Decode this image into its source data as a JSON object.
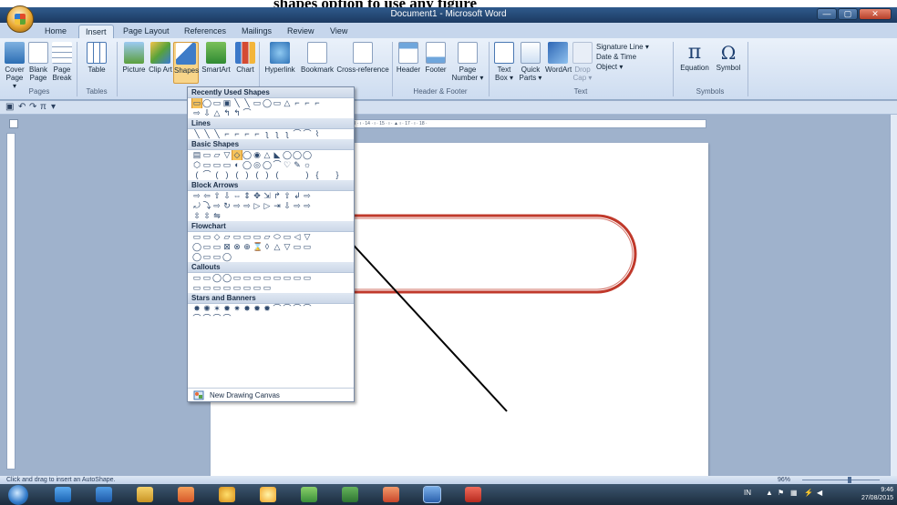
{
  "heading": "shapes option to use any figure",
  "window": {
    "title": "Document1 - Microsoft Word",
    "buttons": [
      "—",
      "▢",
      "✕"
    ]
  },
  "tabs": [
    "Home",
    "Insert",
    "Page Layout",
    "References",
    "Mailings",
    "Review",
    "View"
  ],
  "active_tab": "Insert",
  "ribbon": {
    "pages": {
      "buttons": [
        "Cover Page ▾",
        "Blank Page",
        "Page Break"
      ],
      "label": "Pages"
    },
    "tables": {
      "buttons": [
        "Table"
      ],
      "label": "Tables"
    },
    "illustrations": {
      "buttons": [
        "Picture",
        "Clip Art",
        "Shapes",
        "SmartArt",
        "Chart"
      ],
      "label": "Illustrations"
    },
    "links": {
      "buttons": [
        "Hyperlink",
        "Bookmark",
        "Cross-reference"
      ],
      "label": "Links"
    },
    "header_footer": {
      "buttons": [
        "Header",
        "Footer",
        "Page Number ▾"
      ],
      "label": "Header & Footer"
    },
    "text": {
      "buttons": [
        "Text Box ▾",
        "Quick Parts ▾",
        "WordArt",
        "Drop Cap ▾"
      ],
      "small": [
        "Signature Line ▾",
        "Date & Time",
        "Object ▾"
      ],
      "label": "Text"
    },
    "symbols": {
      "buttons": [
        "Equation",
        "Symbol"
      ],
      "label": "Symbols"
    }
  },
  "shapes_menu": {
    "sections": [
      {
        "title": "Recently Used Shapes",
        "rows": [
          "▭◯▭▣╲╲▭◯▭△⌐⌐⌐",
          "⇨⇩△↰↰⌒"
        ]
      },
      {
        "title": "Lines",
        "rows": [
          "╲╲╲⌐⌐⌐⌐ʅʅʅ⌒⌒⌇"
        ]
      },
      {
        "title": "Basic Shapes",
        "rows": [
          "▤▭▱▽◇◯◉△◣◯◯◯",
          "⬡▭▭▭◐◯◎◯⌒♡✎☼",
          "(⌒()()()(  ){ }"
        ]
      },
      {
        "title": "Block Arrows",
        "rows": [
          "⇨⇦⇧⇩⇔⇕✥⇲↱⇧↲⇨",
          "⤾⤵⇨↻⇨⇨▷▷⇥⇩⇨⇨",
          "⇳⇳⇋"
        ]
      },
      {
        "title": "Flowchart",
        "rows": [
          "▭▭◇▱▭▭▭▱⬭▭◁▽",
          "◯▭▭⊠⊗⊕⌛◊△▽▭▭",
          "◯▭▭◯"
        ]
      },
      {
        "title": "Callouts",
        "rows": [
          "▭▭◯◯▭▭▭▭▭▭▭▭",
          "▭▭▭▭▭▭▭▭"
        ]
      },
      {
        "title": "Stars and Banners",
        "rows": [
          "✸✺✶✹✷✸✹✹⌒⌒⌒⌒",
          "⌒⌒⌒⌒"
        ]
      }
    ],
    "selected_shape": "Rounded Rectangle",
    "footer": "New Drawing Canvas"
  },
  "ruler_text": "· 4 · ı · 5 · ı · 6 · ı · 7 · ı · 8 · ı · 9 · ı · 10 · ı · 11 · ı · 12 · ı · 13 · ı · 14 · ı · 15 · ı · ▲ ı · 17 · ı · 18 ·",
  "status": "Click and drag to insert an AutoShape.",
  "zoom": "96%",
  "taskbar": {
    "tray_lang": "IN",
    "time": "9:46",
    "date": "27/08/2015"
  },
  "colors": {
    "shape_stroke": "#c0392b",
    "arrow": "#000000",
    "accent": "#2e5b8f"
  }
}
